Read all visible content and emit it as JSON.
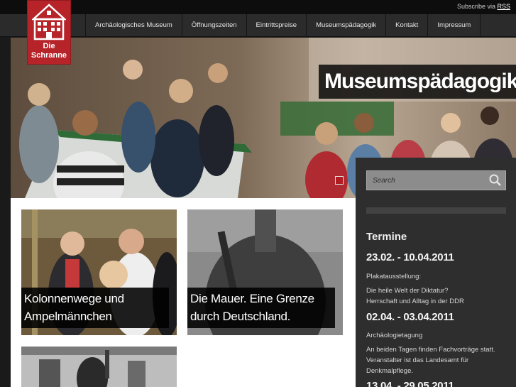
{
  "rss": {
    "prefix": "Subscribe via ",
    "link": "RSS"
  },
  "logo": {
    "line1": "Die",
    "line2": "Schranne"
  },
  "nav": [
    {
      "label": "Archäologisches Museum"
    },
    {
      "label": "Öffnungszeiten"
    },
    {
      "label": "Eintrittspreise"
    },
    {
      "label": "Museumspädagogik"
    },
    {
      "label": "Kontakt"
    },
    {
      "label": "Impressum"
    }
  ],
  "hero": {
    "title": "Museumspädagogik"
  },
  "teasers": [
    {
      "line1": "Kolonnenwege und",
      "line2": "Ampelmännchen"
    },
    {
      "line1": "Die Mauer. Eine Grenze",
      "line2": "durch Deutschland."
    }
  ],
  "search": {
    "placeholder": "Search"
  },
  "events": {
    "heading": "Termine",
    "items": [
      {
        "date": "23.02. - 10.04.2011",
        "lines": [
          "Plakatausstellung:",
          "Die heile Welt der Diktatur?",
          "Herrschaft und Alltag in der DDR"
        ]
      },
      {
        "date": "02.04. - 03.04.2011",
        "lines": [
          "Archäologietagung",
          "An beiden Tagen finden Fachvorträge statt.",
          "Veranstalter ist das Landesamt für",
          "Denkmalpflege."
        ]
      },
      {
        "date": "13.04. - 29.05.2011",
        "lines": []
      }
    ]
  },
  "colors": {
    "brand": "#b6242a",
    "topbar": "#0d0d0d",
    "navbar": "#2b2b2b",
    "sidebar": "#2e2e2e"
  }
}
